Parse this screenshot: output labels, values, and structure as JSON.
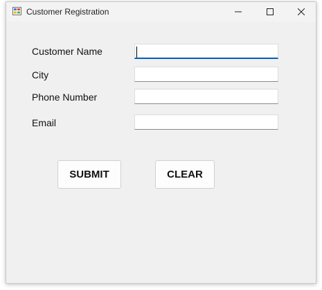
{
  "window": {
    "title": "Customer Registration"
  },
  "form": {
    "customer_name": {
      "label": "Customer Name",
      "value": ""
    },
    "city": {
      "label": "City",
      "value": ""
    },
    "phone_number": {
      "label": "Phone Number",
      "value": ""
    },
    "email": {
      "label": "Email",
      "value": ""
    }
  },
  "buttons": {
    "submit_label": "SUBMIT",
    "clear_label": "CLEAR"
  },
  "colors": {
    "focus_accent": "#005fb8",
    "window_background": "#f0f0f0"
  }
}
